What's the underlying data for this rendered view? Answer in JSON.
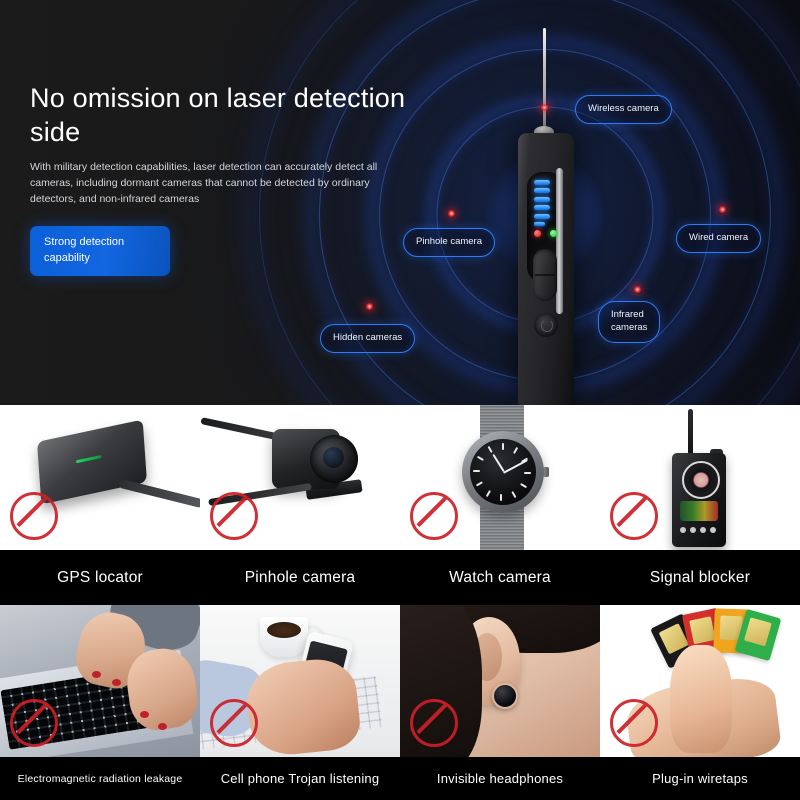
{
  "hero": {
    "headline": "No omission on laser detection side",
    "subhead": "With military detection capabilities, laser detection can accurately detect all cameras, including dormant cameras that cannot be detected by ordinary detectors, and non-infrared cameras",
    "badge": "Strong detection\ncapability",
    "callouts": [
      {
        "label": "Wireless camera"
      },
      {
        "label": "Wired camera"
      },
      {
        "label": "Pinhole camera"
      },
      {
        "label": "Infrared\ncameras"
      },
      {
        "label": "Hidden cameras"
      }
    ],
    "colors": {
      "accent_blue": "#2f7bf5",
      "badge_blue": "#0b5fd8",
      "laser_red": "#ff2a2a",
      "led_blue": "#0a6fe8",
      "background": "#1c1c1c"
    }
  },
  "grid": {
    "row1": [
      {
        "caption": "GPS locator",
        "art": "gps-locator"
      },
      {
        "caption": "Pinhole camera",
        "art": "pinhole-camera"
      },
      {
        "caption": "Watch camera",
        "art": "watch-camera"
      },
      {
        "caption": "Signal blocker",
        "art": "signal-blocker"
      }
    ],
    "row2": [
      {
        "caption": "Electromagnetic radiation leakage",
        "art": "laptop-typing"
      },
      {
        "caption": "Cell phone Trojan listening",
        "art": "phone-in-hand"
      },
      {
        "caption": "Invisible headphones",
        "art": "ear-with-earbud"
      },
      {
        "caption": "Plug-in wiretaps",
        "art": "sim-cards"
      }
    ],
    "prohibition_icon": "no-entry-icon",
    "prohibition_color": "#cc2027"
  }
}
